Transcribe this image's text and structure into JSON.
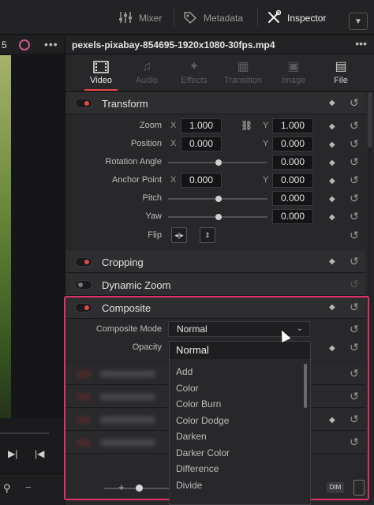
{
  "topbar": {
    "mixer": "Mixer",
    "metadata": "Metadata",
    "inspector": "Inspector"
  },
  "viewer": {
    "number": "5"
  },
  "clip": {
    "title": "pexels-pixabay-854695-1920x1080-30fps.mp4"
  },
  "tabs": [
    {
      "label": "Video",
      "icon": "film-icon",
      "active": true
    },
    {
      "label": "Audio",
      "icon": "music-note-icon",
      "active": false
    },
    {
      "label": "Effects",
      "icon": "effects-icon",
      "active": false
    },
    {
      "label": "Transition",
      "icon": "transition-icon",
      "active": false
    },
    {
      "label": "Image",
      "icon": "image-icon",
      "active": false
    },
    {
      "label": "File",
      "icon": "file-icon",
      "active": false
    }
  ],
  "transform": {
    "title": "Transform",
    "enabled": true,
    "zoom_label": "Zoom",
    "zoom_x": "1.000",
    "zoom_y": "1.000",
    "position_label": "Position",
    "position_x": "0.000",
    "position_y": "0.000",
    "rotation_label": "Rotation Angle",
    "rotation_value": "0.000",
    "anchor_label": "Anchor Point",
    "anchor_x": "0.000",
    "anchor_y": "0.000",
    "pitch_label": "Pitch",
    "pitch_value": "0.000",
    "yaw_label": "Yaw",
    "yaw_value": "0.000",
    "flip_label": "Flip",
    "x_axis": "X",
    "y_axis": "Y"
  },
  "cropping": {
    "title": "Cropping",
    "enabled": true
  },
  "dynamic_zoom": {
    "title": "Dynamic Zoom",
    "enabled": false
  },
  "composite": {
    "title": "Composite",
    "enabled": true,
    "mode_label": "Composite Mode",
    "mode_value": "Normal",
    "opacity_label": "Opacity"
  },
  "dropdown": {
    "selected": "Normal",
    "options": [
      "Add",
      "Color",
      "Color Burn",
      "Color Dodge",
      "Darken",
      "Darker Color",
      "Difference",
      "Divide"
    ]
  },
  "bottom": {
    "dim_label": "DIM",
    "minus": "−",
    "plus": "+"
  },
  "colors": {
    "accent": "#e64646",
    "highlight": "#e0306a"
  }
}
